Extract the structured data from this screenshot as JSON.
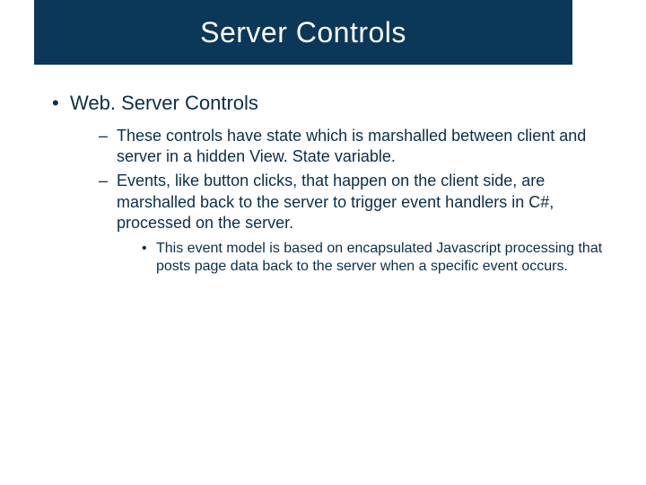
{
  "title": "Server Controls",
  "bullets": {
    "l1_0": "Web. Server Controls",
    "l2_0": "These controls have state which is marshalled between client and server in a hidden View. State variable.",
    "l2_1": "Events, like button clicks, that happen on the client side, are marshalled back to the server to trigger event handlers in C#, processed on the server.",
    "l3_0": "This event model is based on encapsulated Javascript processing that posts page data back to the server when a specific event occurs."
  }
}
